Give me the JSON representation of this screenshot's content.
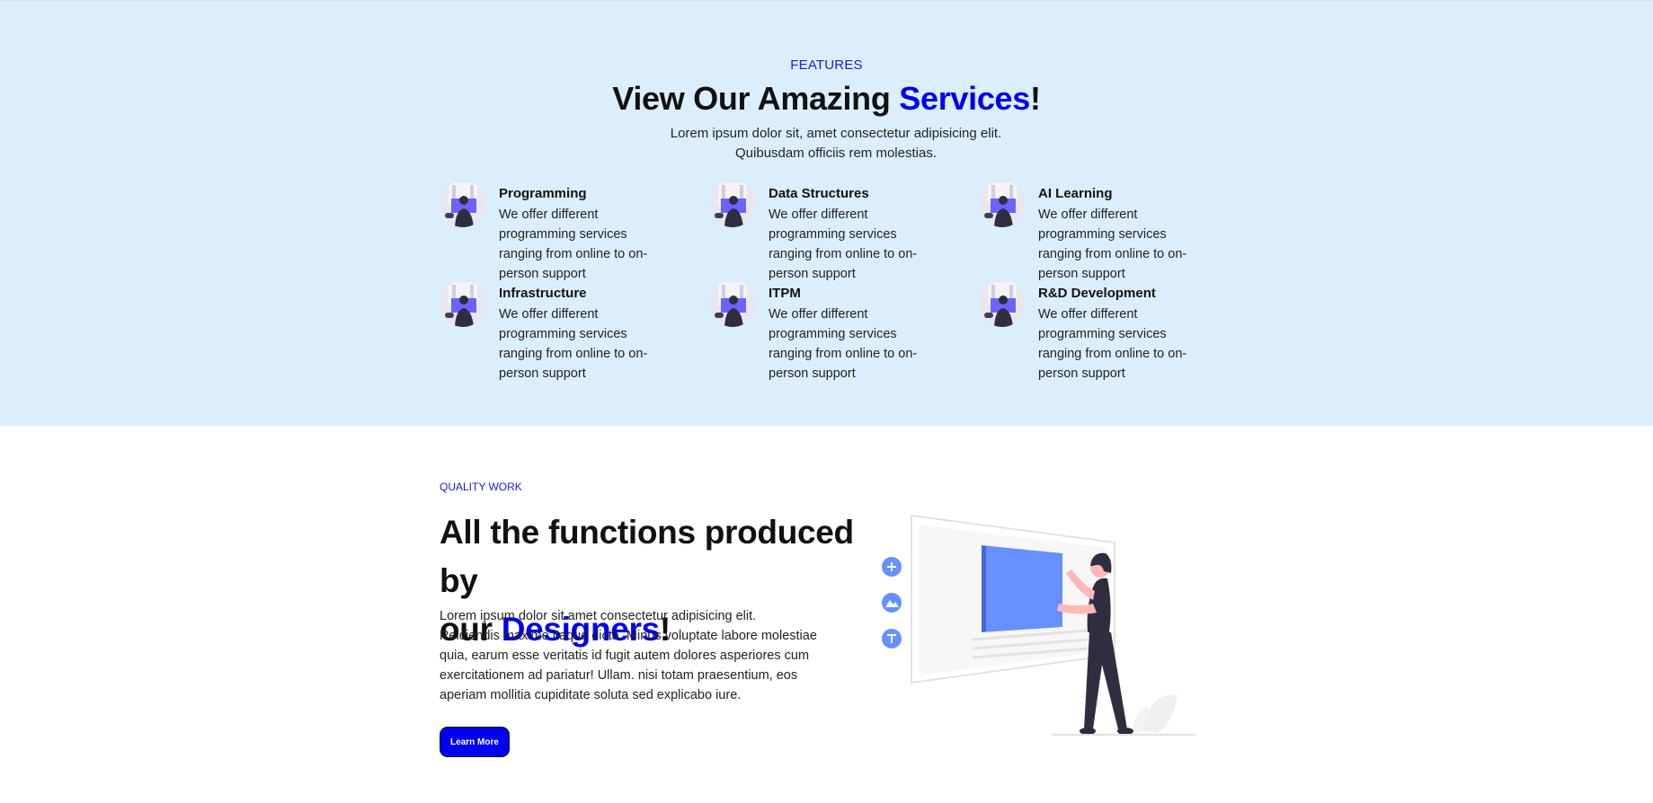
{
  "features": {
    "eyebrow": "FEATURES",
    "title_prefix": "View Our Amazing ",
    "title_accent": "Services",
    "title_suffix": "!",
    "subtitle_line1": "Lorem ipsum dolor sit, amet consectetur adipisicing elit.",
    "subtitle_line2": "Quibusdam officiis rem molestias.",
    "items": [
      {
        "title": "Programming",
        "desc": "We offer different programming services ranging from online to on-person support"
      },
      {
        "title": "Data Structures",
        "desc": "We offer different programming services ranging from online to on-person support"
      },
      {
        "title": "AI Learning",
        "desc": "We offer different programming services ranging from online to on-person support"
      },
      {
        "title": "Infrastructure",
        "desc": "We offer different programming services ranging from online to on-person support"
      },
      {
        "title": "ITPM",
        "desc": "We offer different programming services ranging from online to on-person support"
      },
      {
        "title": "R&D Development",
        "desc": "We offer different programming services ranging from online to on-person support"
      }
    ]
  },
  "quality": {
    "eyebrow": "QUALITY WORK",
    "title_line1": "All the functions produced by",
    "title_prefix2": "our ",
    "title_accent": "Designers",
    "title_suffix": "!",
    "paragraph1": "Lorem ipsum dolor sit amet consectetur adipisicing elit.",
    "paragraph2": "Reiciendis maxime itaque dicta. Minus voluptate labore molestiae quia, earum esse veritatis id fugit autem dolores asperiores cum exercitationem ad pariatur! Ullam. nisi totam praesentium, eos aperiam mollitia cupiditate soluta sed explicabo iure.",
    "button_label": "Learn More"
  },
  "colors": {
    "accent": "#0000f0",
    "features_background": "#dbeefe",
    "button_background": "#0000ee",
    "illustration_screen": "#6690ff"
  }
}
